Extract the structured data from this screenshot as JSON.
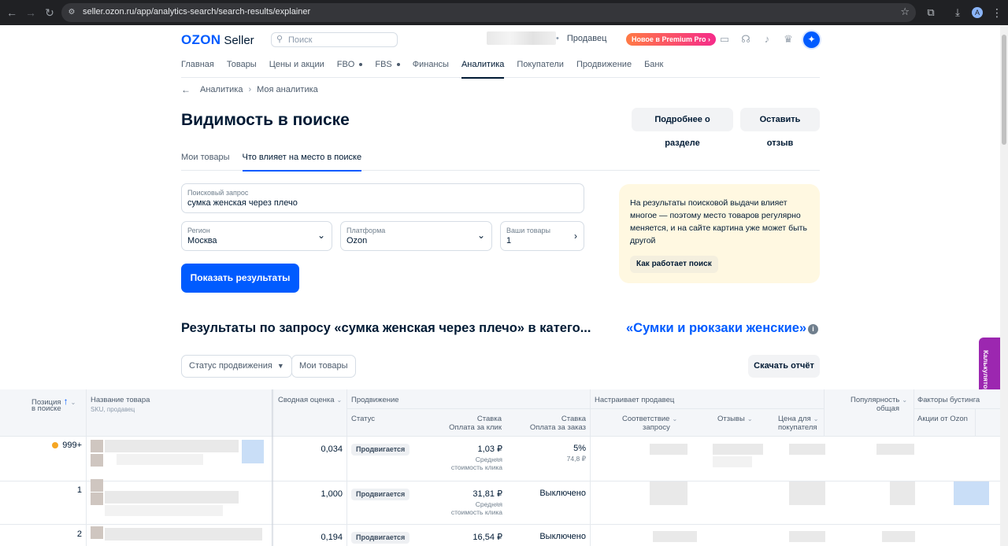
{
  "browser": {
    "url": "seller.ozon.ru/app/analytics-search/search-results/explainer",
    "profile_initial": "A"
  },
  "header": {
    "logo_brand": "OZON",
    "logo_product": "Seller",
    "search_placeholder": "Поиск",
    "role": "Продавец",
    "premium_label": "Новое в Premium Pro"
  },
  "nav": {
    "items": [
      {
        "label": "Главная"
      },
      {
        "label": "Товары"
      },
      {
        "label": "Цены и акции"
      },
      {
        "label": "FBO"
      },
      {
        "label": "FBS"
      },
      {
        "label": "Финансы"
      },
      {
        "label": "Аналитика"
      },
      {
        "label": "Покупатели"
      },
      {
        "label": "Продвижение"
      },
      {
        "label": "Банк"
      }
    ],
    "active": "Аналитика"
  },
  "breadcrumb": {
    "items": [
      "Аналитика",
      "Моя аналитика"
    ]
  },
  "page": {
    "title": "Видимость в поиске",
    "more_button": "Подробнее о разделе",
    "feedback_button": "Оставить отзыв"
  },
  "tabs": [
    {
      "label": "Мои товары"
    },
    {
      "label": "Что влияет на место в поиске"
    }
  ],
  "form": {
    "query_label": "Поисковый запрос",
    "query_value": "сумка женская через плечо",
    "region_label": "Регион",
    "region_value": "Москва",
    "platform_label": "Платформа",
    "platform_value": "Ozon",
    "products_label": "Ваши товары",
    "products_value": "1",
    "submit": "Показать результаты"
  },
  "info": {
    "text": "На результаты поисковой выдачи влияет многое — поэтому место товаров регулярно меняется, и на сайте картина уже может быть другой",
    "how_button": "Как работает поиск"
  },
  "results": {
    "title": "Результаты по запросу «сумка женская через плечо» в катего...",
    "category": "«Сумки и рюкзаки женские»",
    "filter_status": "Статус продвижения",
    "filter_mine": "Мои товары",
    "download": "Скачать отчёт"
  },
  "calculator": {
    "label": "Калькулятор"
  },
  "table": {
    "headers": {
      "position": "Позиция",
      "position2": "в поиске",
      "name": "Название товара",
      "name_sub": "SKU, продавец",
      "score": "Сводная оценка",
      "promo": "Продвижение",
      "status": "Статус",
      "rate_click": "Ставка",
      "rate_click2": "Оплата за клик",
      "rate_order": "Ставка",
      "rate_order2": "Оплата за заказ",
      "seller_group": "Настраивает продавец",
      "match": "Соответствие",
      "match2": "запросу",
      "reviews": "Отзывы",
      "price": "Цена для",
      "price2": "покупателя",
      "popularity": "Популярность",
      "popularity2": "общая",
      "boost": "Факторы бустинга",
      "promo_ozon": "Акции от Ozon"
    },
    "rows": [
      {
        "position": "999+",
        "score": "0,034",
        "status": "Продвигается",
        "rate_click": "1,03 ₽",
        "rate_click_note": "Средняя",
        "rate_click_note2": "стоимость клика",
        "rate_order": "5%",
        "rate_order_note": "74,8 ₽"
      },
      {
        "position": "1",
        "score": "1,000",
        "status": "Продвигается",
        "rate_click": "31,81 ₽",
        "rate_click_note": "Средняя",
        "rate_click_note2": "стоимость клика",
        "rate_order": "Выключено",
        "rate_order_note": ""
      },
      {
        "position": "2",
        "score": "0,194",
        "status": "Продвигается",
        "rate_click": "16,54 ₽",
        "rate_click_note": "",
        "rate_click_note2": "",
        "rate_order": "Выключено",
        "rate_order_note": ""
      }
    ]
  }
}
